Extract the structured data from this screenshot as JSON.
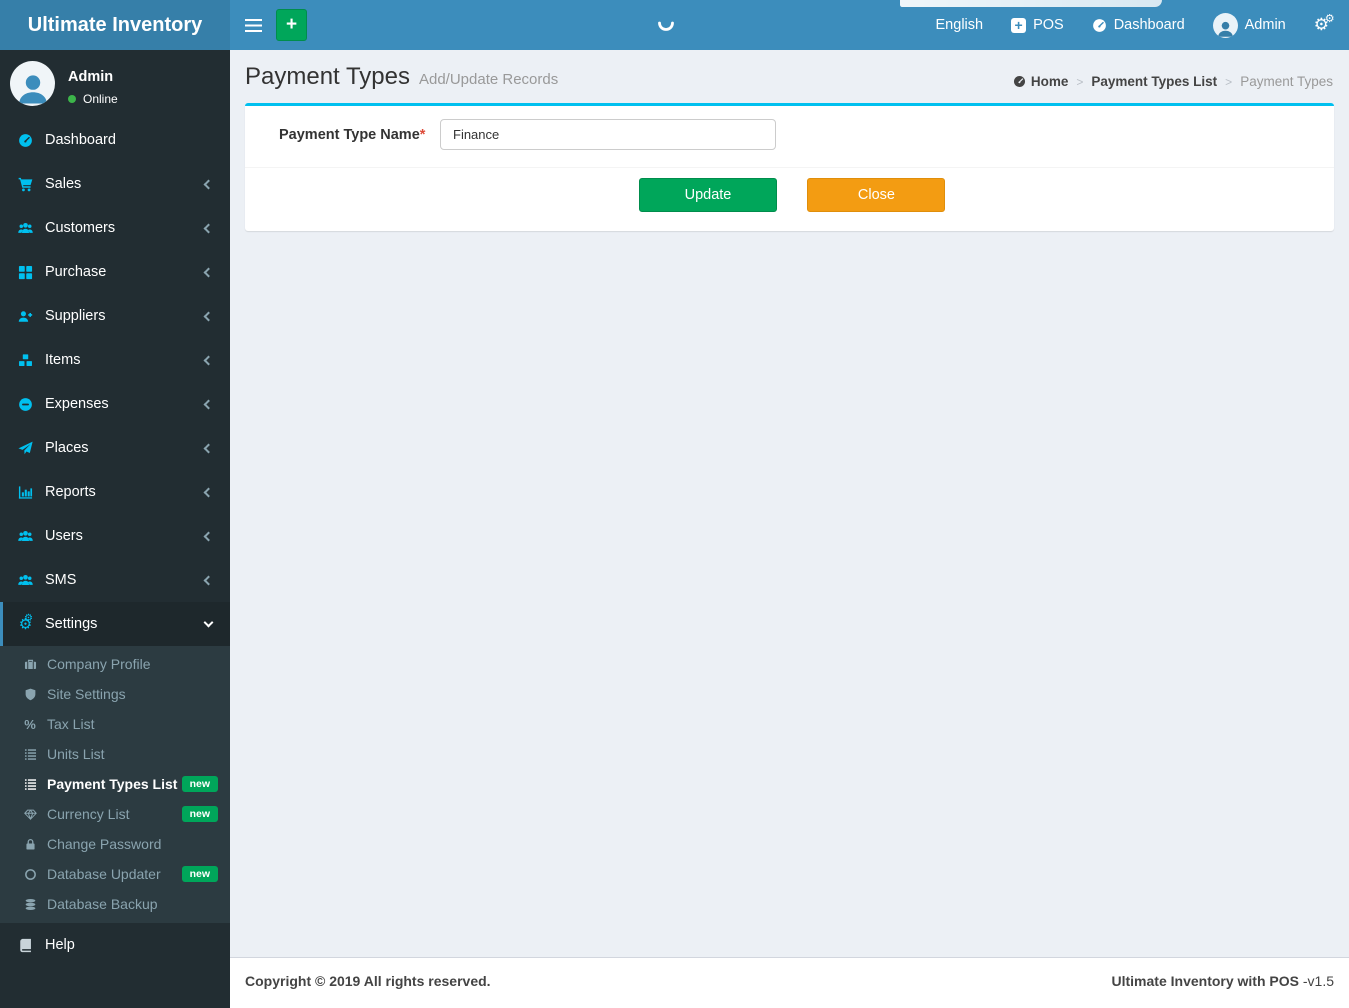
{
  "navbar": {
    "brand": "Ultimate Inventory",
    "add_button": "+",
    "language": "English",
    "pos_label": "POS",
    "dashboard_label": "Dashboard",
    "user_name": "Admin"
  },
  "sidebar": {
    "user_name": "Admin",
    "user_status": "Online",
    "items": [
      {
        "label": "Dashboard",
        "icon": "tachometer-icon"
      },
      {
        "label": "Sales",
        "icon": "cart-icon"
      },
      {
        "label": "Customers",
        "icon": "users-icon"
      },
      {
        "label": "Purchase",
        "icon": "grid-icon"
      },
      {
        "label": "Suppliers",
        "icon": "user-plus-icon"
      },
      {
        "label": "Items",
        "icon": "cubes-icon"
      },
      {
        "label": "Expenses",
        "icon": "minus-circle-icon"
      },
      {
        "label": "Places",
        "icon": "paper-plane-icon"
      },
      {
        "label": "Reports",
        "icon": "bar-chart-icon"
      },
      {
        "label": "Users",
        "icon": "users-icon"
      },
      {
        "label": "SMS",
        "icon": "users-icon"
      },
      {
        "label": "Settings",
        "icon": "gears-icon"
      }
    ],
    "settings_submenu": [
      {
        "label": "Company Profile",
        "icon": "briefcase-icon"
      },
      {
        "label": "Site Settings",
        "icon": "shield-icon"
      },
      {
        "label": "Tax List",
        "icon": "percent-icon"
      },
      {
        "label": "Units List",
        "icon": "list-icon"
      },
      {
        "label": "Payment Types List",
        "icon": "list-icon",
        "badge": "new"
      },
      {
        "label": "Currency List",
        "icon": "diamond-icon",
        "badge": "new"
      },
      {
        "label": "Change Password",
        "icon": "lock-icon"
      },
      {
        "label": "Database Updater",
        "icon": "circle-icon",
        "badge": "new"
      },
      {
        "label": "Database Backup",
        "icon": "database-icon"
      }
    ],
    "help_label": "Help"
  },
  "content": {
    "title": "Payment Types",
    "subtitle": "Add/Update Records",
    "breadcrumb": {
      "home": "Home",
      "parent": "Payment Types List",
      "current": "Payment Types",
      "sep": ">"
    },
    "form": {
      "label": "Payment Type Name",
      "required": "*",
      "value": "Finance"
    },
    "update_button": "Update",
    "close_button": "Close"
  },
  "footer": {
    "copyright": "Copyright © 2019 All rights reserved.",
    "brand": "Ultimate Inventory with POS",
    "version": "-v1.5"
  },
  "icons": {
    "cog": "⚙",
    "percent": "%",
    "plus": "+"
  },
  "colors": {
    "navbar_blue": "#3c8dbc",
    "logo_blue": "#367fa9",
    "sidebar_dark": "#222d32",
    "submenu_dark": "#2c3b41",
    "accent_cyan": "#00c0ef",
    "success_green": "#00a65a",
    "warning_orange": "#f39c12",
    "required_red": "#dd4b39",
    "online_green": "#3cb54a"
  }
}
